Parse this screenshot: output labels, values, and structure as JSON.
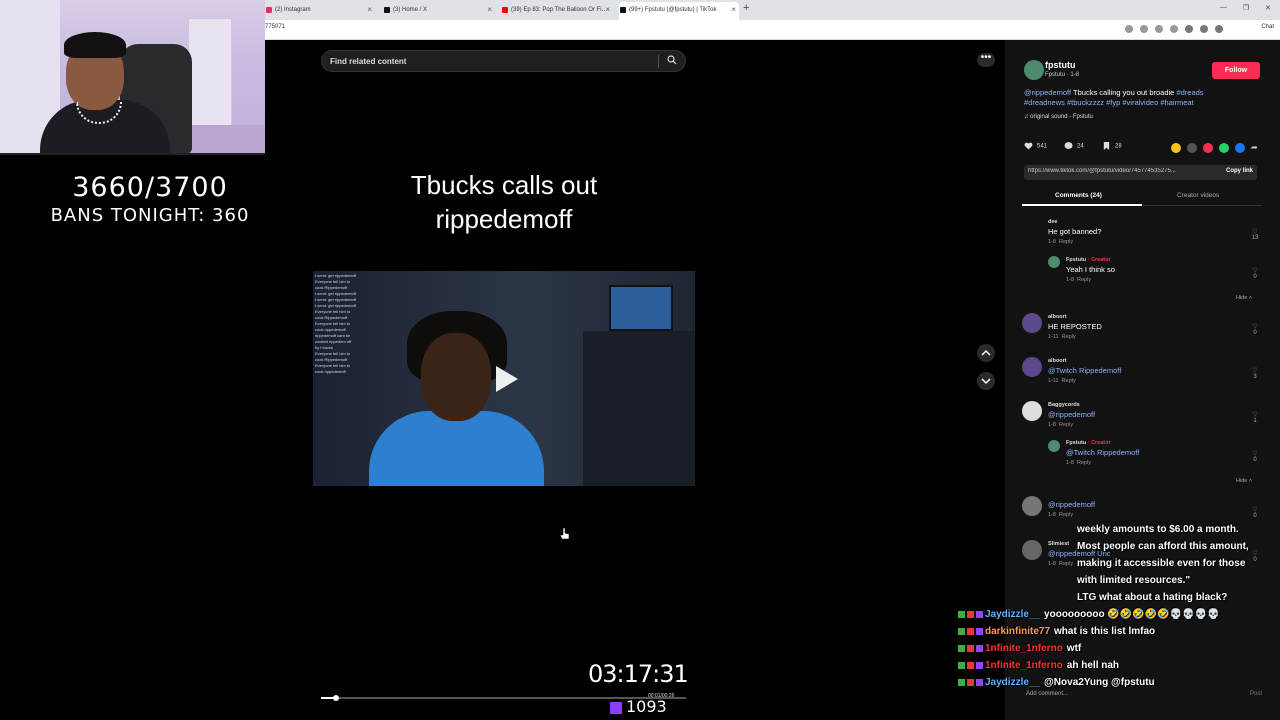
{
  "browser": {
    "tabs": [
      {
        "label": "(2) Instagram",
        "color": "#e1306c"
      },
      {
        "label": "(3) Home / X",
        "color": "#111111"
      },
      {
        "label": "(39) Ep 83: Pop The Balloon Or Fi…",
        "color": "#ff0000"
      },
      {
        "label": "(99+) Fpstutu (@fpstutu) | TikTok",
        "color": "#111111"
      }
    ],
    "new_tab": "+",
    "url": "775071",
    "chat_label": "Chat"
  },
  "overlay": {
    "counter": "3660/3700",
    "bans": "BANS TONIGHT: 360"
  },
  "search": {
    "placeholder": "Find related content"
  },
  "video": {
    "title_line1": "Tbucks calls out",
    "title_line2": "rippedemoff",
    "more": "•••",
    "clock": "03:17:31",
    "timecode": "00:01/00:26",
    "viewers": "1093",
    "progress": 0.04,
    "chat_snippets": [
      "t.send: get rippedemoff",
      "Everyone tell him to",
      "cook Rippedemoff",
      "t.send: get rippedemoff",
      "t.send: get rippedemoff",
      "t.send: get rippedemoff",
      "Everyone tell him to",
      "cook Rippedemoff",
      "Everyone tell him to",
      "cook rippedemoff",
      "rippedemoff cant be",
      "cooked rippedem off",
      "by t bucks",
      "Everyone tell him to",
      "cook Rippedemoff",
      "Everyone tell him to",
      "cook rippedemoff"
    ]
  },
  "creator": {
    "name": "fpstutu",
    "sub": "Fpstutu · 1-8",
    "follow": "Follow",
    "desc_mention": "@rippedemoff",
    "desc_text": " Tbucks calling you out broadie ",
    "desc_tags": "#dreads #dreadnews #tbuckzzzz #fyp #viralvideo #hairmeat",
    "sound": "original sound - Fpstutu",
    "likes": "541",
    "comments": "24",
    "saves": "28",
    "link": "https://www.tiktok.com/@fpstutu/video/745774535275...",
    "copy_link": "Copy link",
    "share_colors": [
      "#f5c518",
      "#555555",
      "#fe2c55",
      "#25d366",
      "#1877f2",
      "#cccccc"
    ]
  },
  "tabs": {
    "comments": "Comments (24)",
    "creator_videos": "Creator videos"
  },
  "comments": [
    {
      "user": "dee",
      "text": "He got banned?",
      "meta": "1-8",
      "reply": "Reply",
      "likes": "13"
    },
    {
      "user": "Fpstutu",
      "creator": "· Creator",
      "text": "Yeah I think so",
      "meta": "1-8",
      "reply": "Reply",
      "likes": "0"
    },
    {
      "user": "alboort",
      "text": "HE REPOSTED",
      "meta": "1-11",
      "reply": "Reply",
      "likes": "0"
    },
    {
      "user": "alboort",
      "text": "@Twitch Rippedemoff",
      "meta": "1-11",
      "reply": "Reply",
      "likes": "3"
    },
    {
      "user": "Baggycords",
      "text": "@rippedemoff",
      "meta": "1-8",
      "reply": "Reply",
      "likes": "1"
    },
    {
      "user": "Fpstutu",
      "creator": "· Creator",
      "text": "@Twitch Rippedemoff",
      "meta": "1-8",
      "reply": "Reply",
      "likes": "0"
    },
    {
      "user": "",
      "text": "@rippedemoff",
      "meta": "1-8",
      "reply": "Reply",
      "likes": "0"
    },
    {
      "user": "Slimiest",
      "text": "@rippedemoff Unc",
      "meta": "1-8",
      "reply": "Reply",
      "likes": "0"
    }
  ],
  "hide": "Hide",
  "stream_chat": [
    {
      "name": "",
      "color": "#ffffff",
      "msg": "weekly amounts to $6.00 a month."
    },
    {
      "name": "",
      "color": "#ffffff",
      "msg": "Most people can afford this amount,"
    },
    {
      "name": "",
      "color": "#ffffff",
      "msg": "making it accessible even for those"
    },
    {
      "name": "",
      "color": "#ffffff",
      "msg": "with limited resources.\""
    },
    {
      "name": "",
      "color": "#ffffff",
      "msg": "LTG what about a hating black?"
    },
    {
      "name": "Jaydizzle__",
      "color": "#5fb0ff",
      "msg": "yooooooooo 🤣🤣🤣🤣🤣💀💀💀💀"
    },
    {
      "name": "darkinfinite77",
      "color": "#ff9a5a",
      "msg": "what is this list lmfao"
    },
    {
      "name": "1nfinite_1nferno",
      "color": "#ff3030",
      "msg": "wtf"
    },
    {
      "name": "1nfinite_1nferno",
      "color": "#ff3030",
      "msg": "ah hell nah"
    },
    {
      "name": "Jaydizzle__",
      "color": "#5fb0ff",
      "msg": "@Nova2Yung @fpstutu"
    }
  ],
  "comment_bar": {
    "placeholder": "Add comment...",
    "post": "Post"
  }
}
